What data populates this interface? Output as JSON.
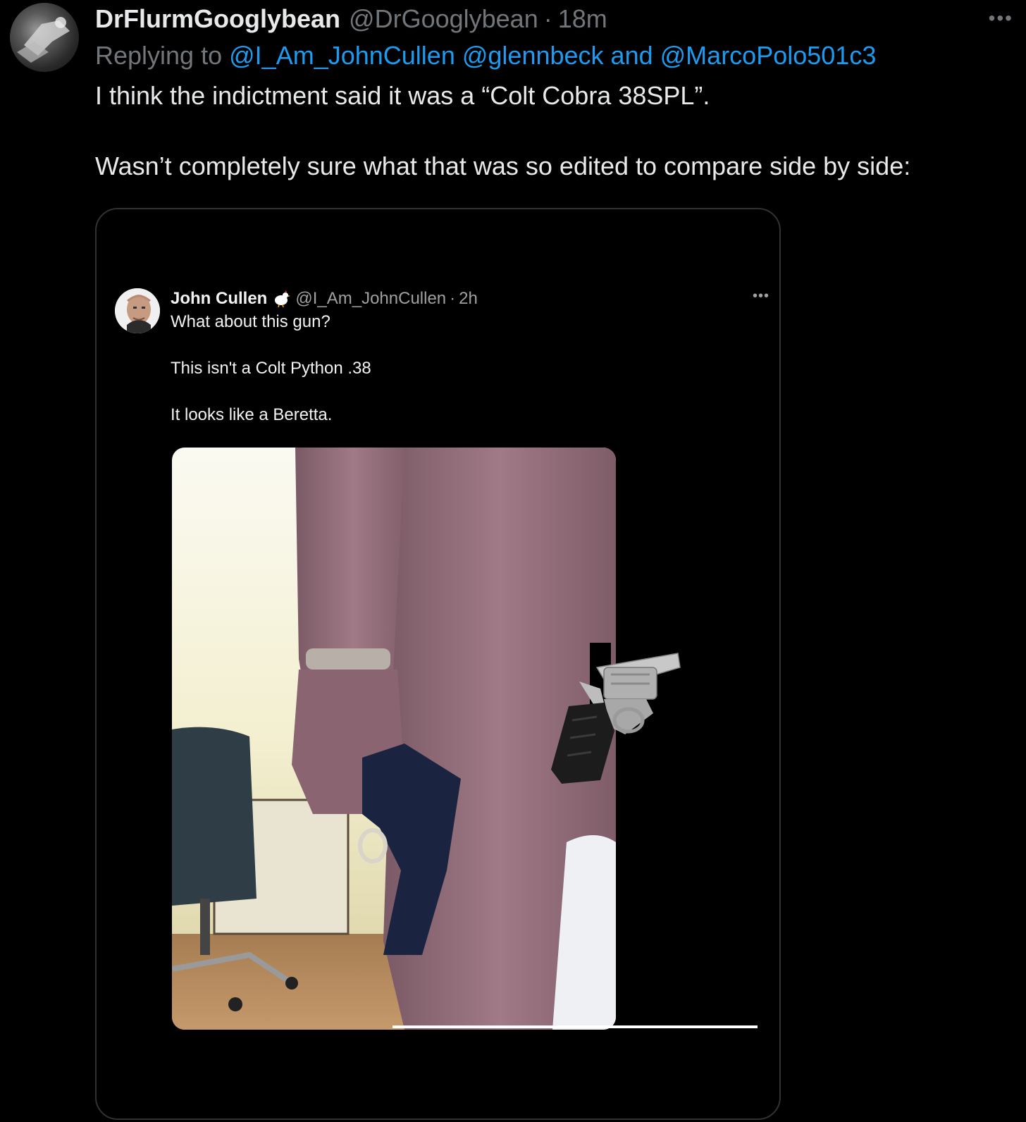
{
  "tweet": {
    "display_name": "DrFlurmGooglybean",
    "handle": "@DrGooglybean",
    "separator": "·",
    "time": "18m",
    "more": "•••",
    "replying_prefix": "Replying to",
    "mentions": [
      "@I_Am_JohnCullen",
      "@glennbeck"
    ],
    "mentions_and": "and",
    "mention_last": "@MarcoPolo501c3",
    "text_line1": "I think the indictment said it was a “Colt Cobra 38SPL”.",
    "text_line2": "Wasn’t completely sure what that was so edited to compare side by side:"
  },
  "embedded": {
    "name": "John Cullen",
    "handle": "@I_Am_JohnCullen",
    "separator": "·",
    "time": "2h",
    "more": "•••",
    "line1": "What about this gun?",
    "line2": "This isn't a Colt Python .38",
    "line3": "It looks like a Beretta."
  },
  "colors": {
    "background": "#000000",
    "text": "#e7e9ea",
    "muted": "#71767b",
    "link": "#1d9bf0",
    "border": "#2f3336"
  },
  "icons": [
    "avatar-image",
    "chicken-icon",
    "more-icon",
    "pistol-image",
    "revolver-image"
  ]
}
